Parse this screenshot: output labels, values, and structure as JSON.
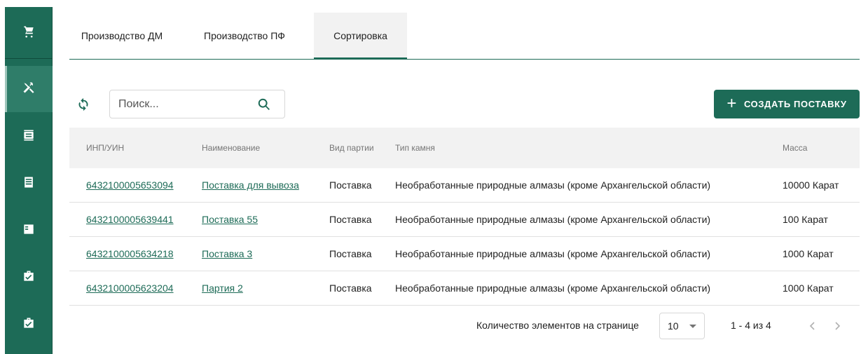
{
  "sidebar": {
    "items": [
      {
        "icon": "cart-icon"
      },
      {
        "icon": "tools-icon",
        "active": true
      },
      {
        "icon": "id-card-icon"
      },
      {
        "icon": "document-list-icon"
      },
      {
        "icon": "checklist-icon"
      },
      {
        "icon": "briefcase-check-icon"
      },
      {
        "icon": "briefcase-check-icon"
      }
    ],
    "color": "#1d6b57"
  },
  "tabs": [
    {
      "label": "Производство ДМ"
    },
    {
      "label": "Производство ПФ"
    },
    {
      "label": "Сортировка",
      "active": true
    }
  ],
  "toolbar": {
    "search_placeholder": "Поиск...",
    "create_label": "СОЗДАТЬ ПОСТАВКУ",
    "create_icon": "plus-icon"
  },
  "table": {
    "columns": [
      "ИНП/УИН",
      "Наименование",
      "Вид партии",
      "Тип камня",
      "Масса"
    ],
    "rows": [
      [
        "6432100005653094",
        "Поставка для вывоза",
        "Поставка",
        "Необработанные природные алмазы (кроме Архангельской области)",
        "10000 Карат"
      ],
      [
        "6432100005639441",
        "Поставка 55",
        "Поставка",
        "Необработанные природные алмазы (кроме Архангельской области)",
        "100 Карат"
      ],
      [
        "6432100005634218",
        "Поставка 3",
        "Поставка",
        "Необработанные природные алмазы (кроме Архангельской области)",
        "1000 Карат"
      ],
      [
        "6432100005623204",
        "Партия 2",
        "Поставка",
        "Необработанные природные алмазы (кроме Архангельской области)",
        "1000 Карат"
      ]
    ]
  },
  "pagination": {
    "page_size_label": "Количество элементов на странице",
    "page_size": "10",
    "range": "1 - 4 из 4"
  },
  "colors": {
    "accent": "#1d6b57",
    "header_bg": "#f2f2f2"
  }
}
